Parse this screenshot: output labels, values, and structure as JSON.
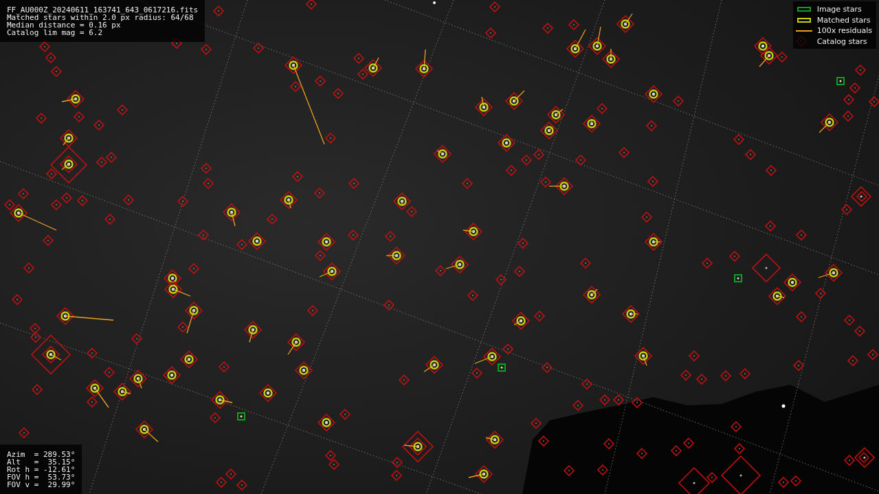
{
  "file_info": {
    "lines": [
      "FF_AU000Z_20240611_163741_643_0617216.fits",
      "Matched stars within 2.0 px radius: 64/68",
      "Median distance = 0.16 px",
      "Catalog lim mag = 6.2"
    ]
  },
  "legend": [
    {
      "kind": "image",
      "label": "Image stars"
    },
    {
      "kind": "matched",
      "label": "Matched stars"
    },
    {
      "kind": "residual",
      "label": "100x residuals"
    },
    {
      "kind": "catalog",
      "label": "Catalog stars"
    }
  ],
  "camera_info": {
    "lines": [
      "Azim  = 289.53°",
      "Alt   =  35.15°",
      "Rot h = -12.61°",
      "FOV h =  53.73°",
      "FOV v =  29.99°"
    ]
  }
}
